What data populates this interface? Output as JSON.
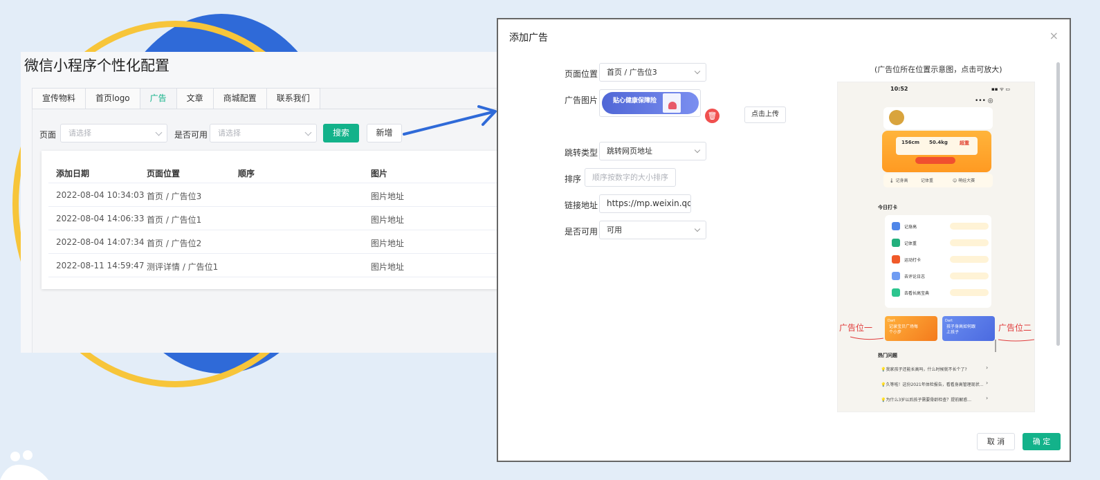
{
  "left": {
    "title": "微信小程序个性化配置",
    "tabs": [
      "宣传物料",
      "首页logo",
      "广告",
      "文章",
      "商城配置",
      "联系我们"
    ],
    "active_tab": 2,
    "filters": {
      "page_label": "页面",
      "page_placeholder": "请选择",
      "enabled_label": "是否可用",
      "enabled_placeholder": "请选择",
      "search_button": "搜索",
      "add_button": "新增"
    },
    "table": {
      "headers": [
        "添加日期",
        "页面位置",
        "顺序",
        "图片"
      ],
      "rows": [
        {
          "date": "2022-08-04 10:34:03",
          "position": "首页 / 广告位3",
          "image": "图片地址"
        },
        {
          "date": "2022-08-04 14:06:33",
          "position": "首页 / 广告位1",
          "image": "图片地址"
        },
        {
          "date": "2022-08-04 14:07:34",
          "position": "首页 / 广告位2",
          "image": "图片地址"
        },
        {
          "date": "2022-08-11 14:59:47",
          "position": "测评详情 / 广告位1",
          "image": "图片地址"
        }
      ]
    }
  },
  "dialog": {
    "title": "添加广告",
    "close_glyph": "×",
    "fields": {
      "page_position_label": "页面位置",
      "page_position_value": "首页 / 广告位3",
      "ad_image_label": "广告图片",
      "banner_text": "贴心健康保障险",
      "upload_button": "点击上传",
      "delete_glyph": "🗑",
      "jump_type_label": "跳转类型",
      "jump_type_value": "跳转网页地址",
      "sort_label": "排序",
      "sort_placeholder": "顺序按数字的大小排序",
      "link_label": "链接地址",
      "link_value": "https://mp.weixin.qq.c",
      "enabled_label": "是否可用",
      "enabled_value": "可用"
    },
    "hint": "(广告位所在位置示意图，点击可放大)",
    "preview": {
      "time": "10:52",
      "status": "▪▪ ᯤ ▭",
      "menu": "•••  ◎",
      "stats": [
        "156cm",
        "50.4kg",
        "超重"
      ],
      "chips": [
        "🌡 记身高",
        "记体重",
        "☺ 萌娃大赛"
      ],
      "section_title": "今日打卡",
      "list_items": [
        "记身高",
        "记体重",
        "运动打卡",
        "去评论日志",
        "去看长高宝典"
      ],
      "ad_tag": "Dart",
      "ad1_text": "记录宝贝广场每个小步",
      "ad2_text": "孩子身高如何跟上孩子",
      "label_ad1": "广告位一",
      "label_ad2": "广告位二",
      "hot_title": "热门问题",
      "questions": [
        "💡我家孩子还能长高吗，什么时候就不长个了?",
        "💡久等啦！这份2021年体检报告，看看身高管理现状...",
        "💡为什么3岁以后孩子需要骨龄检查？提前解惑..."
      ]
    },
    "cancel_button": "取 消",
    "ok_button": "确 定"
  },
  "colors": {
    "primary_green": "#13b28a",
    "arrow_blue": "#2f6ad8",
    "delete_red": "#f0504f"
  }
}
